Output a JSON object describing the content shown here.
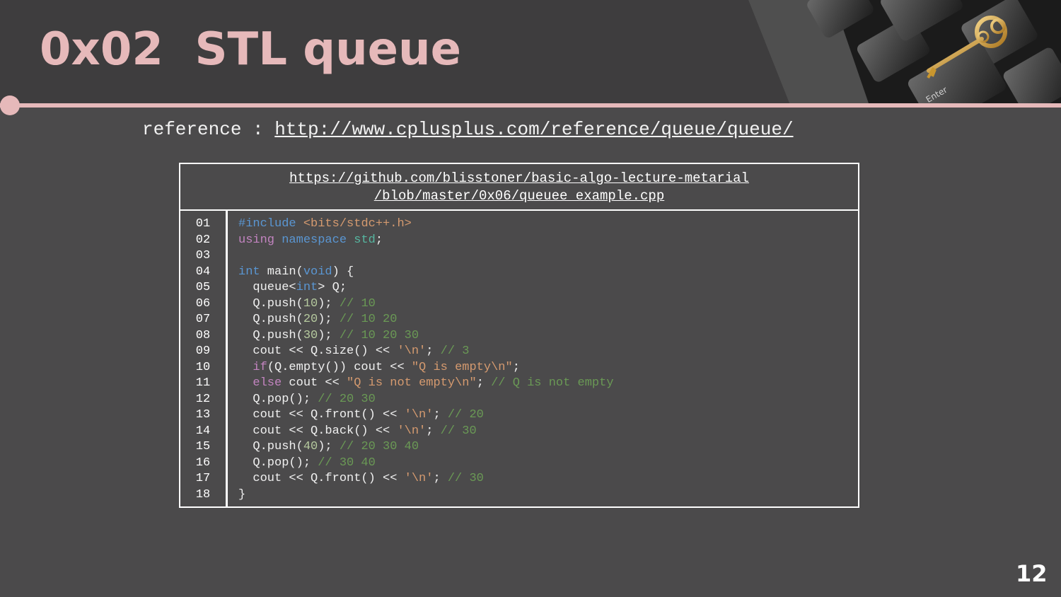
{
  "slide": {
    "title": "0x02  STL queue",
    "page_number": "12",
    "colors": {
      "accent": "#e6b9ba",
      "background": "#4b4a4b",
      "header": "#3e3d3e"
    }
  },
  "reference": {
    "label": "reference : ",
    "url": "http://www.cplusplus.com/reference/queue/queue/"
  },
  "code_box": {
    "link_line1": "https://github.com/blisstoner/basic-algo-lecture-metarial",
    "link_line2": "/blob/master/0x06/queuee_example.cpp",
    "line_numbers": [
      "01",
      "02",
      "03",
      "04",
      "05",
      "06",
      "07",
      "08",
      "09",
      "10",
      "11",
      "12",
      "13",
      "14",
      "15",
      "16",
      "17",
      "18"
    ],
    "lines": [
      [
        {
          "t": "#include",
          "c": "kw"
        },
        {
          "t": " <bits/stdc++.h>",
          "c": "str"
        }
      ],
      [
        {
          "t": "using",
          "c": "kw2"
        },
        {
          "t": " "
        },
        {
          "t": "namespace",
          "c": "kw"
        },
        {
          "t": " "
        },
        {
          "t": "std",
          "c": "ns"
        },
        {
          "t": ";"
        }
      ],
      [],
      [
        {
          "t": "int",
          "c": "kw"
        },
        {
          "t": " main("
        },
        {
          "t": "void",
          "c": "kw"
        },
        {
          "t": ") {"
        }
      ],
      [
        {
          "t": "  queue<"
        },
        {
          "t": "int",
          "c": "kw"
        },
        {
          "t": "> Q;"
        }
      ],
      [
        {
          "t": "  Q.push("
        },
        {
          "t": "10",
          "c": "num"
        },
        {
          "t": "); "
        },
        {
          "t": "// 10",
          "c": "cm"
        }
      ],
      [
        {
          "t": "  Q.push("
        },
        {
          "t": "20",
          "c": "num"
        },
        {
          "t": "); "
        },
        {
          "t": "// 10 20",
          "c": "cm"
        }
      ],
      [
        {
          "t": "  Q.push("
        },
        {
          "t": "30",
          "c": "num"
        },
        {
          "t": "); "
        },
        {
          "t": "// 10 20 30",
          "c": "cm"
        }
      ],
      [
        {
          "t": "  cout << Q.size() << "
        },
        {
          "t": "'\\n'",
          "c": "str"
        },
        {
          "t": "; "
        },
        {
          "t": "// 3",
          "c": "cm"
        }
      ],
      [
        {
          "t": "  "
        },
        {
          "t": "if",
          "c": "kw2"
        },
        {
          "t": "(Q.empty()) cout << "
        },
        {
          "t": "\"Q is empty\\n\"",
          "c": "str"
        },
        {
          "t": ";"
        }
      ],
      [
        {
          "t": "  "
        },
        {
          "t": "else",
          "c": "kw2"
        },
        {
          "t": " cout << "
        },
        {
          "t": "\"Q is not empty\\n\"",
          "c": "str"
        },
        {
          "t": "; "
        },
        {
          "t": "// Q is not empty",
          "c": "cm"
        }
      ],
      [
        {
          "t": "  Q.pop(); "
        },
        {
          "t": "// 20 30",
          "c": "cm"
        }
      ],
      [
        {
          "t": "  cout << Q.front() << "
        },
        {
          "t": "'\\n'",
          "c": "str"
        },
        {
          "t": "; "
        },
        {
          "t": "// 20",
          "c": "cm"
        }
      ],
      [
        {
          "t": "  cout << Q.back() << "
        },
        {
          "t": "'\\n'",
          "c": "str"
        },
        {
          "t": "; "
        },
        {
          "t": "// 30",
          "c": "cm"
        }
      ],
      [
        {
          "t": "  Q.push("
        },
        {
          "t": "40",
          "c": "num"
        },
        {
          "t": "); "
        },
        {
          "t": "// 20 30 40",
          "c": "cm"
        }
      ],
      [
        {
          "t": "  Q.pop(); "
        },
        {
          "t": "// 30 40",
          "c": "cm"
        }
      ],
      [
        {
          "t": "  cout << Q.front() << "
        },
        {
          "t": "'\\n'",
          "c": "str"
        },
        {
          "t": "; "
        },
        {
          "t": "// 30",
          "c": "cm"
        }
      ],
      [
        {
          "t": "}"
        }
      ]
    ]
  },
  "photo": {
    "keycap_label": "Enter"
  }
}
